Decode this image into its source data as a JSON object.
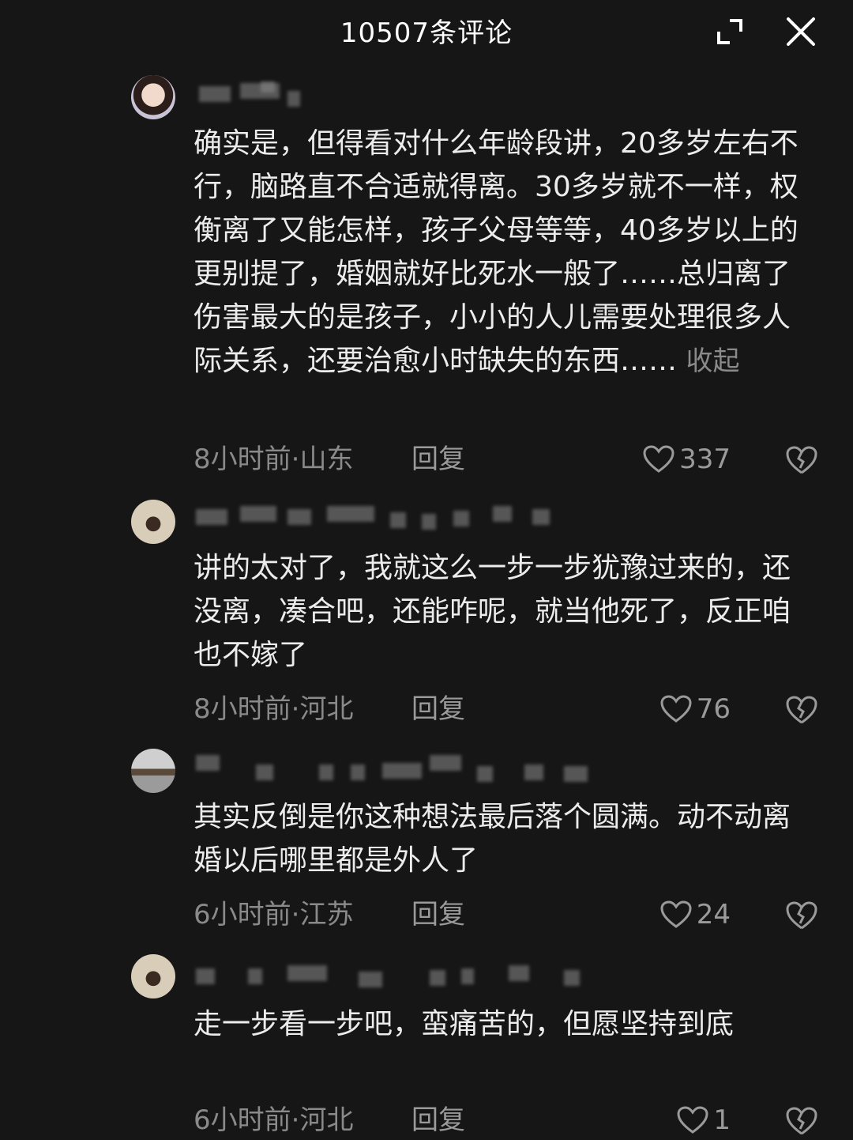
{
  "header": {
    "title": "10507条评论",
    "expand_icon": "expand-icon",
    "close_icon": "close-icon"
  },
  "comments": [
    {
      "avatar_icon": "user-avatar",
      "text": "确实是，但得看对什么年龄段讲，20多岁左右不行，脑路直不合适就得离。30多岁就不一样，权衡离了又能怎样，孩子父母等等，40多岁以上的更别提了，婚姻就好比死水一般了……总归离了伤害最大的是孩子，小小的人儿需要处理很多人际关系，还要治愈小时缺失的东西……",
      "collapse_label": "收起",
      "meta": "8小时前·山东",
      "reply_label": "回复",
      "likes": "337"
    },
    {
      "avatar_icon": "user-avatar",
      "text": "讲的太对了，我就这么一步一步犹豫过来的，还没离，凑合吧，还能咋呢，就当他死了，反正咱也不嫁了",
      "meta": "8小时前·河北",
      "reply_label": "回复",
      "likes": "76"
    },
    {
      "avatar_icon": "user-avatar",
      "text": "其实反倒是你这种想法最后落个圆满。动不动离婚以后哪里都是外人了",
      "meta": "6小时前·江苏",
      "reply_label": "回复",
      "likes": "24"
    },
    {
      "avatar_icon": "user-avatar",
      "text": "走一步看一步吧，蛮痛苦的，但愿坚持到底",
      "meta": "6小时前·河北",
      "reply_label": "回复",
      "likes": "1"
    }
  ],
  "colors": {
    "background": "#161616",
    "text": "#ececec",
    "muted": "#8a8a8a"
  }
}
